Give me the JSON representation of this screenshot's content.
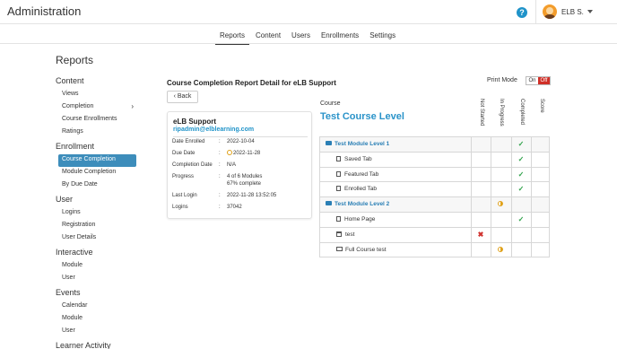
{
  "header": {
    "app_title": "Administration",
    "help_icon": "question-circle-icon",
    "user_name": "ELB S."
  },
  "nav": {
    "tabs": [
      {
        "label": "Reports",
        "active": true
      },
      {
        "label": "Content",
        "active": false
      },
      {
        "label": "Users",
        "active": false
      },
      {
        "label": "Enrollments",
        "active": false
      },
      {
        "label": "Settings",
        "active": false
      }
    ]
  },
  "sidebar": {
    "heading": "Reports",
    "content": {
      "title": "Content",
      "items": [
        "Views",
        "Completion",
        "Course Enrollments",
        "Ratings"
      ]
    },
    "enrollment": {
      "title": "Enrollment",
      "items": [
        "Course Completion",
        "Module Completion",
        "By Due Date"
      ],
      "active": "Course Completion"
    },
    "user": {
      "title": "User",
      "items": [
        "Logins",
        "Registration",
        "User Details"
      ]
    },
    "interactive": {
      "title": "Interactive",
      "items": [
        "Module",
        "User"
      ]
    },
    "events": {
      "title": "Events",
      "items": [
        "Calendar",
        "Module",
        "User"
      ]
    },
    "learner_activity": {
      "title": "Learner Activity"
    }
  },
  "report": {
    "title": "Course Completion Report Detail for eLB Support",
    "back_label": "Back",
    "print_mode_label": "Print Mode",
    "toggle_on": "On",
    "toggle_off": "Off"
  },
  "learner": {
    "name": "eLB Support",
    "email": "ripadmin@elblearning.com",
    "fields": [
      {
        "label": "Date Enrolled",
        "value": "2022-10-04"
      },
      {
        "label": "Due Date",
        "value": "2022-11-28"
      },
      {
        "label": "Completion Date",
        "value": "N/A"
      },
      {
        "label": "Progress",
        "value": "4 of 6 Modules",
        "value2": "67% complete"
      },
      {
        "label": "Last Login",
        "value": "2022-11-28 13:52:05"
      },
      {
        "label": "Logins",
        "value": "37042"
      }
    ]
  },
  "course": {
    "label": "Course",
    "title": "Test Course Level",
    "columns": [
      "Not Started",
      "In Progress",
      "Completed",
      "Score"
    ],
    "rows": [
      {
        "name": "Test Module Level 1",
        "kind": "module",
        "status": "completed"
      },
      {
        "name": "Saved Tab",
        "kind": "page",
        "status": "completed"
      },
      {
        "name": "Featured Tab",
        "kind": "page",
        "status": "completed"
      },
      {
        "name": "Enrolled Tab",
        "kind": "page",
        "status": "completed"
      },
      {
        "name": "Test Module Level 2",
        "kind": "module",
        "status": "in-progress"
      },
      {
        "name": "Home Page",
        "kind": "page",
        "status": "completed"
      },
      {
        "name": "test",
        "kind": "event",
        "status": "not-started"
      },
      {
        "name": "Full Course test",
        "kind": "test",
        "status": "in-progress"
      }
    ]
  }
}
